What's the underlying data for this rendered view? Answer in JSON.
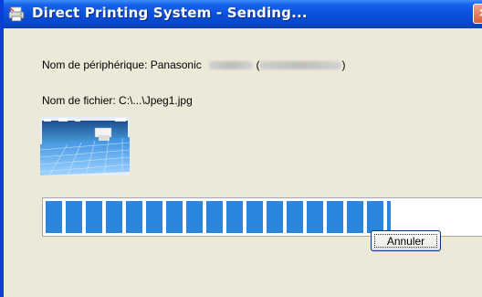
{
  "window": {
    "title": "Direct Printing System - Sending...",
    "title_icon": "printer-icon",
    "close_icon": "close-icon"
  },
  "device": {
    "label": "Nom de périphérique: Panasonic",
    "close_paren": ")",
    "open_paren": "("
  },
  "file": {
    "label": "Nom de fichier: C:\\...\\Jpeg1.jpg"
  },
  "thumbnail": {
    "description_icon": "image-thumbnail"
  },
  "progress": {
    "fraction": 0.79
  },
  "buttons": {
    "cancel_label": "Annuler"
  },
  "colors": {
    "titlebar": "#0a4fd8",
    "window_bg": "#ece9d8",
    "progress_block": "#2a86dd"
  }
}
